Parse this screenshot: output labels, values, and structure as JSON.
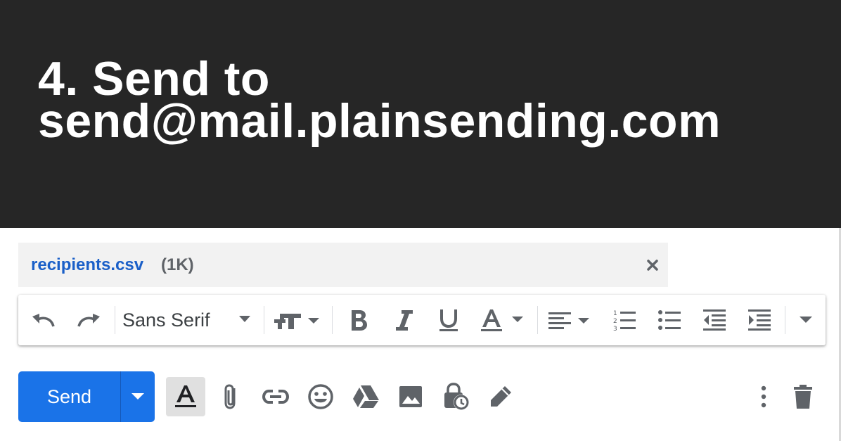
{
  "banner": {
    "line1": "4. Send to",
    "line2": "send@mail.plainsending.com"
  },
  "attachment": {
    "name": "recipients.csv",
    "size": "(1K)",
    "close_icon": "close-icon"
  },
  "toolbar": {
    "font_family": "Sans Serif",
    "items": [
      "undo-icon",
      "redo-icon",
      "font-family-dropdown",
      "text-size-icon",
      "bold-icon",
      "italic-icon",
      "underline-icon",
      "text-color-icon",
      "align-icon",
      "numbered-list-icon",
      "bulleted-list-icon",
      "indent-less-icon",
      "indent-more-icon",
      "more-formatting-icon"
    ]
  },
  "actions": {
    "send_label": "Send",
    "icons": [
      "formatting-options-icon",
      "attach-file-icon",
      "insert-link-icon",
      "emoji-icon",
      "google-drive-icon",
      "insert-photo-icon",
      "confidential-mode-icon",
      "signature-icon",
      "more-options-icon",
      "discard-icon"
    ]
  },
  "colors": {
    "banner_bg": "#262626",
    "send_blue": "#1a73e8",
    "link_blue": "#1a5fc8",
    "icon_gray": "#5f6368"
  }
}
